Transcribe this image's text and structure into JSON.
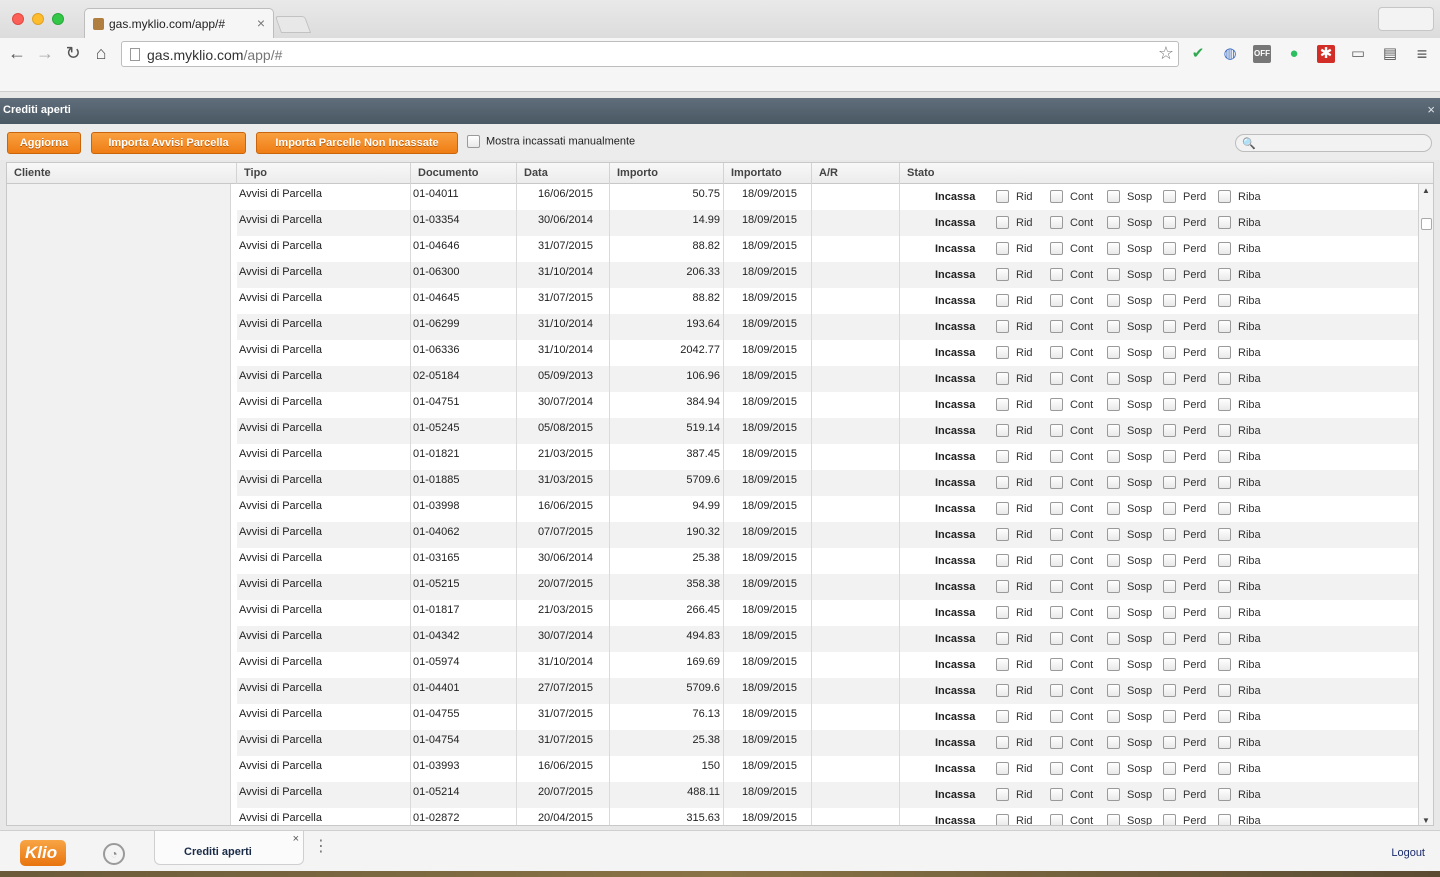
{
  "browser": {
    "tab_title": "gas.myklio.com/app/#",
    "tab_close": "×",
    "url_host": "gas.myklio.com",
    "url_path": "/app/#",
    "back_icon": "←",
    "forward_icon": "→",
    "reload_icon": "↻",
    "home_icon": "⌂",
    "bookmark_icon": "☆",
    "menu_icon": "≡",
    "extensions": [
      {
        "name": "check-extension-icon",
        "glyph": "✔",
        "color": "#2fa84f"
      },
      {
        "name": "globe-extension-icon",
        "glyph": "◍",
        "color": "#3d6fc4"
      },
      {
        "name": "off-extension-icon",
        "glyph": "OFF",
        "color": "#666666"
      },
      {
        "name": "evernote-extension-icon",
        "glyph": "●",
        "color": "#2dbe60"
      },
      {
        "name": "lastpass-extension-icon",
        "glyph": "✱",
        "color": "#d32d27"
      },
      {
        "name": "cast-extension-icon",
        "glyph": "▭",
        "color": "#666666"
      },
      {
        "name": "clapper-extension-icon",
        "glyph": "▤",
        "color": "#555555"
      }
    ]
  },
  "panel": {
    "title": "Crediti aperti",
    "close": "×"
  },
  "actions": {
    "refresh_label": "Aggiorna",
    "import_avvisi_label": "Importa Avvisi Parcella",
    "import_parcelle_label": "Importa Parcelle Non Incassate",
    "show_manual_label": "Mostra incassati manualmente",
    "search_placeholder": "",
    "search_icon": "🔍"
  },
  "columns": {
    "cliente": "Cliente",
    "tipo": "Tipo",
    "documento": "Documento",
    "data": "Data",
    "importo": "Importo",
    "importato": "Importato",
    "ar": "A/R",
    "stato": "Stato"
  },
  "stato_labels": {
    "incassa": "Incassa",
    "rid": "Rid",
    "cont": "Cont",
    "sosp": "Sosp",
    "perd": "Perd",
    "riba": "Riba"
  },
  "rows": [
    {
      "tipo": "Avvisi di Parcella",
      "documento": "01-04011",
      "data": "16/06/2015",
      "importo": "50.75",
      "importato": "18/09/2015",
      "ar": ""
    },
    {
      "tipo": "Avvisi di Parcella",
      "documento": "01-03354",
      "data": "30/06/2014",
      "importo": "14.99",
      "importato": "18/09/2015",
      "ar": ""
    },
    {
      "tipo": "Avvisi di Parcella",
      "documento": "01-04646",
      "data": "31/07/2015",
      "importo": "88.82",
      "importato": "18/09/2015",
      "ar": ""
    },
    {
      "tipo": "Avvisi di Parcella",
      "documento": "01-06300",
      "data": "31/10/2014",
      "importo": "206.33",
      "importato": "18/09/2015",
      "ar": ""
    },
    {
      "tipo": "Avvisi di Parcella",
      "documento": "01-04645",
      "data": "31/07/2015",
      "importo": "88.82",
      "importato": "18/09/2015",
      "ar": ""
    },
    {
      "tipo": "Avvisi di Parcella",
      "documento": "01-06299",
      "data": "31/10/2014",
      "importo": "193.64",
      "importato": "18/09/2015",
      "ar": ""
    },
    {
      "tipo": "Avvisi di Parcella",
      "documento": "01-06336",
      "data": "31/10/2014",
      "importo": "2042.77",
      "importato": "18/09/2015",
      "ar": ""
    },
    {
      "tipo": "Avvisi di Parcella",
      "documento": "02-05184",
      "data": "05/09/2013",
      "importo": "106.96",
      "importato": "18/09/2015",
      "ar": ""
    },
    {
      "tipo": "Avvisi di Parcella",
      "documento": "01-04751",
      "data": "30/07/2014",
      "importo": "384.94",
      "importato": "18/09/2015",
      "ar": ""
    },
    {
      "tipo": "Avvisi di Parcella",
      "documento": "01-05245",
      "data": "05/08/2015",
      "importo": "519.14",
      "importato": "18/09/2015",
      "ar": ""
    },
    {
      "tipo": "Avvisi di Parcella",
      "documento": "01-01821",
      "data": "21/03/2015",
      "importo": "387.45",
      "importato": "18/09/2015",
      "ar": ""
    },
    {
      "tipo": "Avvisi di Parcella",
      "documento": "01-01885",
      "data": "31/03/2015",
      "importo": "5709.6",
      "importato": "18/09/2015",
      "ar": ""
    },
    {
      "tipo": "Avvisi di Parcella",
      "documento": "01-03998",
      "data": "16/06/2015",
      "importo": "94.99",
      "importato": "18/09/2015",
      "ar": ""
    },
    {
      "tipo": "Avvisi di Parcella",
      "documento": "01-04062",
      "data": "07/07/2015",
      "importo": "190.32",
      "importato": "18/09/2015",
      "ar": ""
    },
    {
      "tipo": "Avvisi di Parcella",
      "documento": "01-03165",
      "data": "30/06/2014",
      "importo": "25.38",
      "importato": "18/09/2015",
      "ar": ""
    },
    {
      "tipo": "Avvisi di Parcella",
      "documento": "01-05215",
      "data": "20/07/2015",
      "importo": "358.38",
      "importato": "18/09/2015",
      "ar": ""
    },
    {
      "tipo": "Avvisi di Parcella",
      "documento": "01-01817",
      "data": "21/03/2015",
      "importo": "266.45",
      "importato": "18/09/2015",
      "ar": ""
    },
    {
      "tipo": "Avvisi di Parcella",
      "documento": "01-04342",
      "data": "30/07/2014",
      "importo": "494.83",
      "importato": "18/09/2015",
      "ar": ""
    },
    {
      "tipo": "Avvisi di Parcella",
      "documento": "01-05974",
      "data": "31/10/2014",
      "importo": "169.69",
      "importato": "18/09/2015",
      "ar": ""
    },
    {
      "tipo": "Avvisi di Parcella",
      "documento": "01-04401",
      "data": "27/07/2015",
      "importo": "5709.6",
      "importato": "18/09/2015",
      "ar": ""
    },
    {
      "tipo": "Avvisi di Parcella",
      "documento": "01-04755",
      "data": "31/07/2015",
      "importo": "76.13",
      "importato": "18/09/2015",
      "ar": ""
    },
    {
      "tipo": "Avvisi di Parcella",
      "documento": "01-04754",
      "data": "31/07/2015",
      "importo": "25.38",
      "importato": "18/09/2015",
      "ar": ""
    },
    {
      "tipo": "Avvisi di Parcella",
      "documento": "01-03993",
      "data": "16/06/2015",
      "importo": "150",
      "importato": "18/09/2015",
      "ar": ""
    },
    {
      "tipo": "Avvisi di Parcella",
      "documento": "01-05214",
      "data": "20/07/2015",
      "importo": "488.11",
      "importato": "18/09/2015",
      "ar": ""
    },
    {
      "tipo": "Avvisi di Parcella",
      "documento": "01-02872",
      "data": "20/04/2015",
      "importo": "315.63",
      "importato": "18/09/2015",
      "ar": ""
    }
  ],
  "footer": {
    "logo_text": "Klio",
    "dashboard_icon": "◔",
    "task_tab_label": "Crediti aperti",
    "task_tab_close": "×",
    "more_icon": "⋮",
    "logout_label": "Logout"
  },
  "scroll": {
    "up_icon": "▲",
    "down_icon": "▼"
  }
}
